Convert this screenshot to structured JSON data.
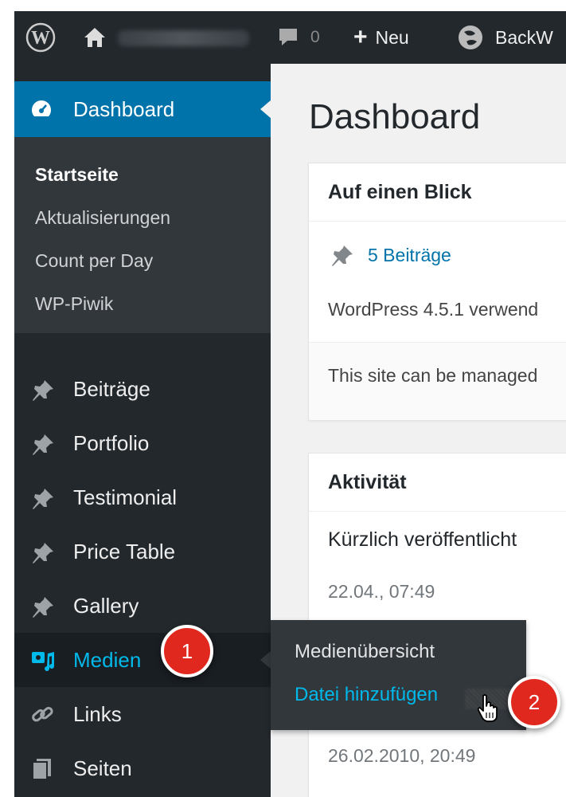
{
  "adminbar": {
    "comments_count": "0",
    "new_label": "Neu",
    "backup_label": "BackW"
  },
  "sidebar": {
    "dashboard_label": "Dashboard",
    "submenu": [
      "Startseite",
      "Aktualisierungen",
      "Count per Day",
      "WP-Piwik"
    ],
    "items": [
      {
        "label": "Beiträge",
        "icon": "pin-icon"
      },
      {
        "label": "Portfolio",
        "icon": "pin-icon"
      },
      {
        "label": "Testimonial",
        "icon": "pin-icon"
      },
      {
        "label": "Price Table",
        "icon": "pin-icon"
      },
      {
        "label": "Gallery",
        "icon": "pin-icon"
      },
      {
        "label": "Medien",
        "icon": "media-icon"
      },
      {
        "label": "Links",
        "icon": "link-icon"
      },
      {
        "label": "Seiten",
        "icon": "pages-icon"
      }
    ]
  },
  "flyout": {
    "items": [
      "Medienübersicht",
      "Datei hinzufügen"
    ]
  },
  "badges": [
    "1",
    "2"
  ],
  "main": {
    "title": "Dashboard",
    "glance": {
      "title": "Auf einen Blick",
      "posts_link": "5 Beiträge",
      "version_text": "WordPress 4.5.1 verwend",
      "footer_text": "This site can be managed"
    },
    "activity": {
      "title": "Aktivität",
      "subtitle": "Kürzlich veröffentlicht",
      "dates": [
        "22.04., 07:49",
        "26.02.2010, 20:49"
      ]
    }
  },
  "colors": {
    "adminbar_bg": "#23282d",
    "accent": "#0073aa",
    "highlight_text": "#00b9eb",
    "badge": "#e0281e"
  }
}
